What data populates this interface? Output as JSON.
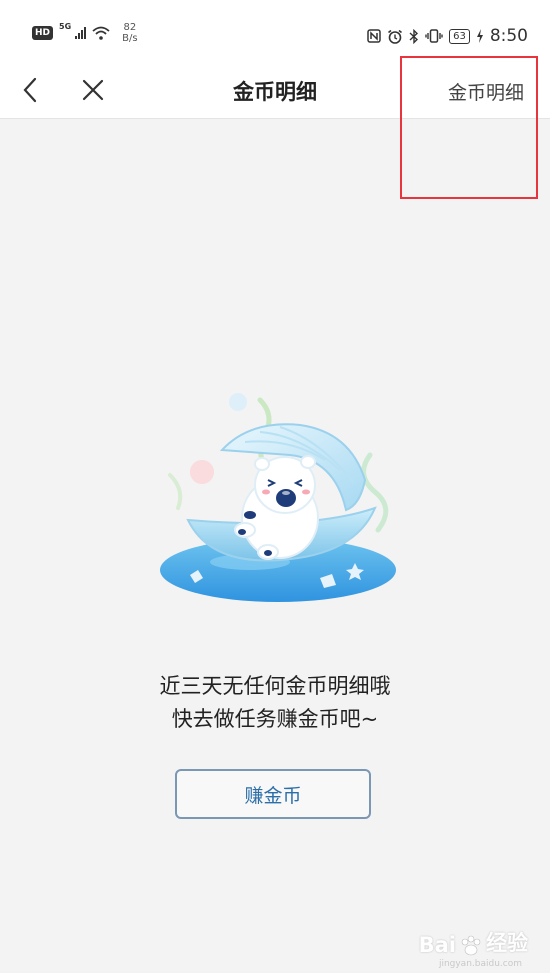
{
  "status_bar": {
    "hd": "HD",
    "network": "5G",
    "speed_value": "82",
    "speed_unit": "B/s",
    "battery": "63",
    "time": "8:50",
    "icons": [
      "nfc-icon",
      "alarm-icon",
      "bluetooth-icon",
      "vibrate-icon",
      "battery-icon",
      "charging-icon"
    ]
  },
  "nav": {
    "title": "金币明细",
    "action_label": "金币明细",
    "back_icon": "chevron-left-icon",
    "close_icon": "close-icon"
  },
  "empty_state": {
    "line1": "近三天无任何金币明细哦",
    "line2": "快去做任务赚金币吧~",
    "button_label": "赚金币"
  },
  "watermark": {
    "brand": "Bai",
    "brand_tail": "经验",
    "url": "jingyan.baidu.com"
  },
  "colors": {
    "accent": "#2b6ea8",
    "highlight": "#e8343d",
    "background": "#f3f3f3"
  }
}
